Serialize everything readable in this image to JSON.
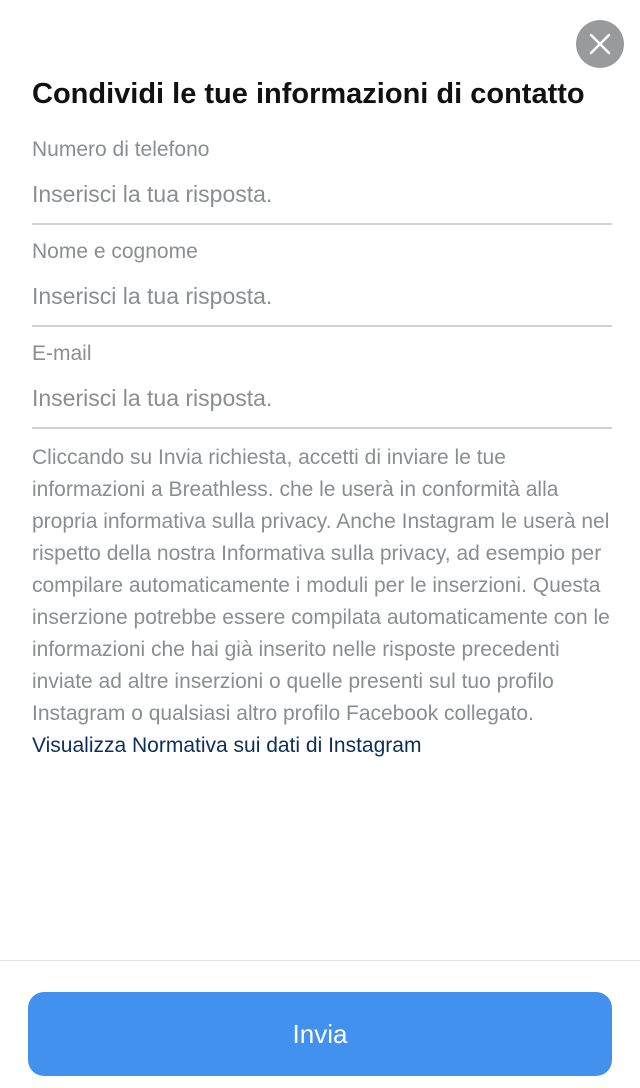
{
  "header": {
    "title": "Condividi le tue informazioni di contatto",
    "close_icon": "close-icon"
  },
  "form": {
    "fields": [
      {
        "label": "Numero di telefono",
        "placeholder": "Inserisci la tua risposta.",
        "value": ""
      },
      {
        "label": "Nome e cognome",
        "placeholder": "Inserisci la tua risposta.",
        "value": ""
      },
      {
        "label": "E-mail",
        "placeholder": "Inserisci la tua risposta.",
        "value": ""
      }
    ]
  },
  "disclaimer": {
    "text": "Cliccando su Invia richiesta, accetti di inviare le tue informazioni a Breathless. che le userà in conformità alla propria informativa sulla privacy. Anche Instagram le userà nel rispetto della nostra Informativa sulla privacy, ad esempio per compilare automaticamente i moduli per le inserzioni. Questa inserzione potrebbe essere compilata automaticamente con le informazioni che hai già inserito nelle risposte precedenti inviate ad altre inserzioni o quelle presenti sul tuo profilo Instagram o qualsiasi altro profilo Facebook collegato.",
    "link_label": "Visualizza Normativa sui dati di Instagram"
  },
  "footer": {
    "submit_label": "Invia"
  },
  "colors": {
    "accent": "#4391ee",
    "link": "#0b2f5c",
    "muted_text": "#8a8d91",
    "close_button": "#999a9c"
  }
}
